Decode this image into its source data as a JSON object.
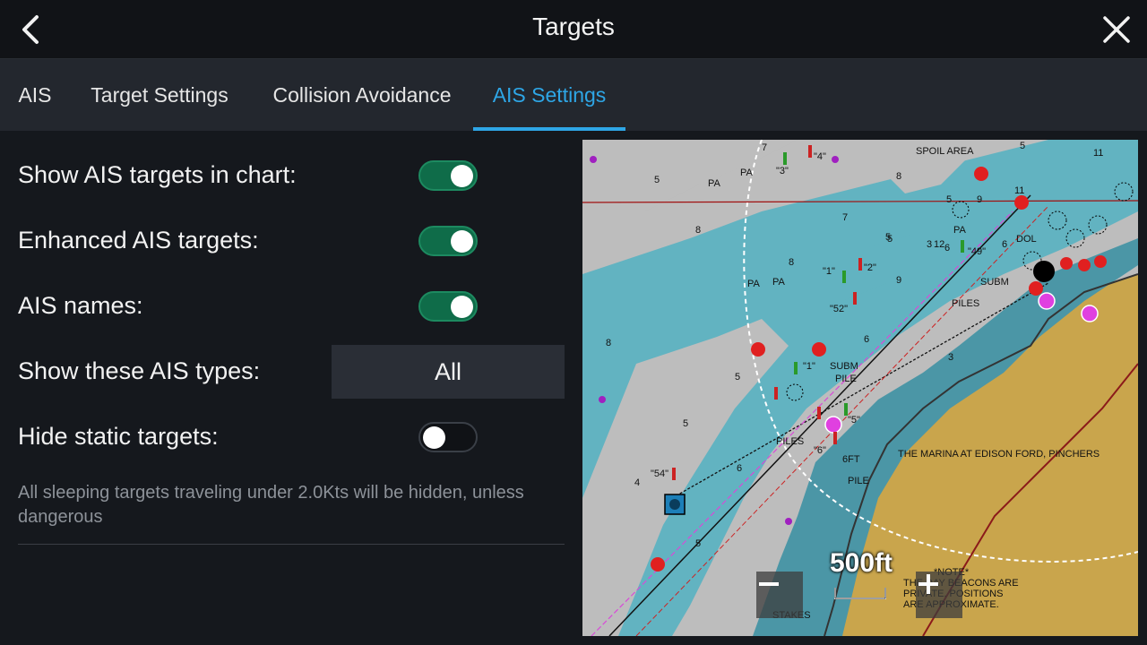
{
  "header": {
    "title": "Targets",
    "back_icon": "chevron-left-icon",
    "close_icon": "close-icon"
  },
  "tabs": [
    {
      "label": "AIS",
      "active": false
    },
    {
      "label": "Target Settings",
      "active": false
    },
    {
      "label": "Collision Avoidance",
      "active": false
    },
    {
      "label": "AIS Settings",
      "active": true
    }
  ],
  "settings": {
    "show_ais_targets": {
      "label": "Show AIS targets in chart:",
      "on": true
    },
    "enhanced_ais": {
      "label": "Enhanced AIS targets:",
      "on": true
    },
    "ais_names": {
      "label": "AIS names:",
      "on": true
    },
    "ais_types": {
      "label": "Show these AIS types:",
      "value": "All"
    },
    "hide_static": {
      "label": "Hide static targets:",
      "on": false
    },
    "note": "All sleeping targets traveling under 2.0Kts will be hidden, unless dangerous"
  },
  "chart": {
    "scale_label": "500ft",
    "zoom_out_icon": "minus-icon",
    "zoom_in_icon": "plus-icon",
    "labels": {
      "spoil_area": "SPOIL AREA",
      "subm": "SUBM",
      "piles": "PILES",
      "subm_pile": "SUBM PILE",
      "marina": "THE MARINA AT EDISON FORD, PINCHERS",
      "pile": "PILE",
      "stakes": "STAKES",
      "note_title": "*NOTE*",
      "note_line1": "THE DAY BEACONS ARE",
      "note_line2": "PRIVATE. POSITIONS",
      "note_line3": "ARE APPROXIMATE.",
      "six_ft": "6FT",
      "pa": "PA",
      "dol": "DOL",
      "beacon_4": "\"4\"",
      "beacon_3": "\"3\"",
      "beacon_1": "\"1\"",
      "beacon_2": "\"2\"",
      "beacon_52": "\"52\"",
      "beacon_49": "\"49\"",
      "beacon_54": "\"54\"",
      "beacon_5": "\"5\"",
      "beacon_6": "\"6\""
    },
    "colors": {
      "land": "#c9a54c",
      "shallow": "#62b3c1",
      "deep": "#bdbdbd",
      "mid": "#4b96a6",
      "red_marker": "#e02020",
      "ais_target": "#e040e0"
    }
  }
}
